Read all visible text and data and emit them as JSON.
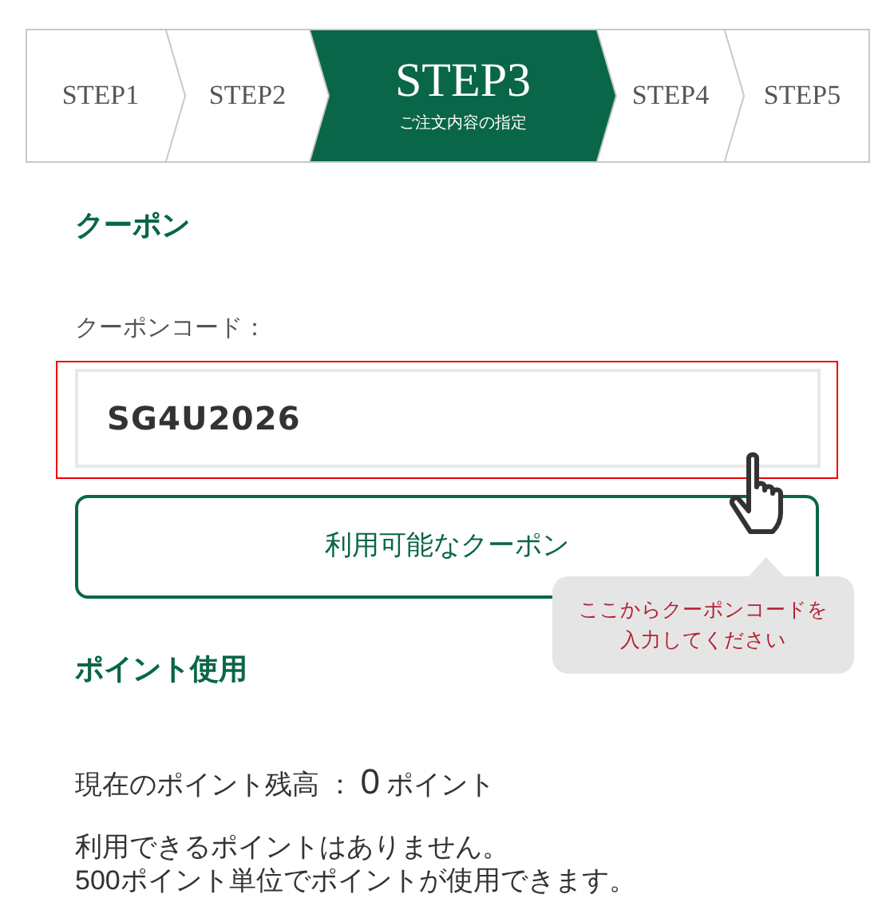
{
  "steps": [
    {
      "label": "STEP1",
      "selected": false
    },
    {
      "label": "STEP2",
      "selected": false
    },
    {
      "label": "STEP3",
      "subtitle": "ご注文内容の指定",
      "selected": true
    },
    {
      "label": "STEP4",
      "selected": false
    },
    {
      "label": "STEP5",
      "selected": false
    }
  ],
  "coupon": {
    "heading": "クーポン",
    "field_label": "クーポンコード：",
    "value": "SG4U2026",
    "button": "利用可能なクーポン",
    "tooltip_lines": [
      "ここからクーポンコードを",
      "入力してください"
    ]
  },
  "points": {
    "heading": "ポイント使用",
    "balance_label": "現在のポイント残高 ：",
    "balance_value": "0",
    "balance_unit": "ポイント",
    "notes": [
      "利用できるポイントはありません。",
      "500ポイント単位でポイントが使用できます。"
    ]
  }
}
